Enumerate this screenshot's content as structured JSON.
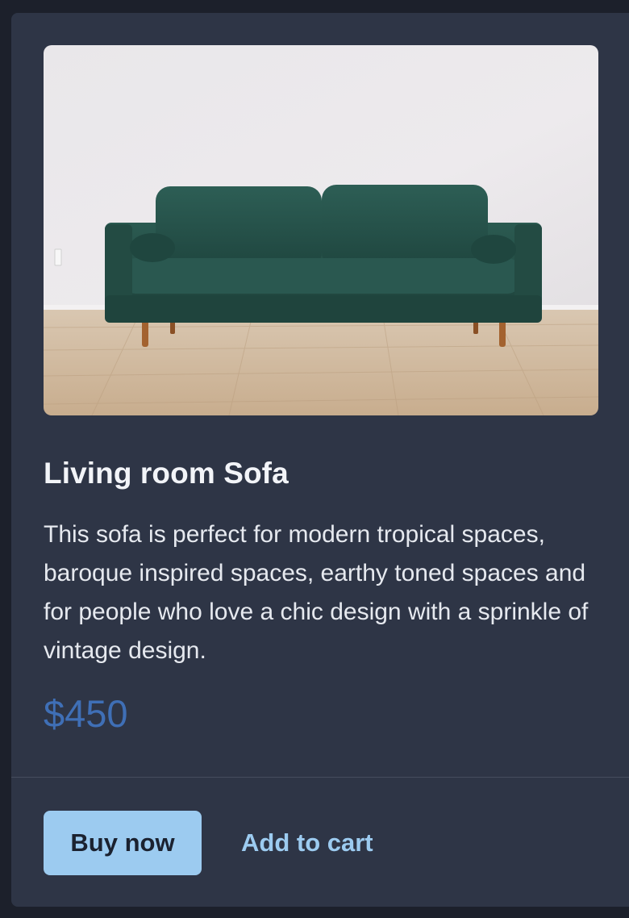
{
  "product": {
    "image_name": "green-velvet-sofa-photo",
    "title": "Living room Sofa",
    "description": "This sofa is perfect for modern tropical spaces, baroque inspired spaces, earthy toned spaces and for people who love a chic design with a sprinkle of vintage design.",
    "price": "$450"
  },
  "actions": {
    "buy_label": "Buy now",
    "cart_label": "Add to cart"
  },
  "colors": {
    "page_background": "#1c202b",
    "card_background": "#2e3546",
    "price": "#3f6fb6",
    "primary_button": "#9ccbf0",
    "link": "#9ccbf0",
    "sofa": "#234a43"
  }
}
